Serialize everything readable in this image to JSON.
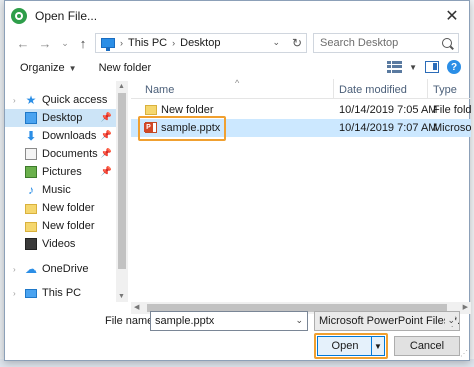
{
  "window": {
    "title": "Open File...",
    "close_glyph": "✕"
  },
  "nav": {
    "back_glyph": "←",
    "forward_glyph": "→",
    "recent_glyph": "⌄",
    "up_glyph": "↑",
    "breadcrumb": [
      "This PC",
      "Desktop"
    ],
    "crumb_sep": "›",
    "address_dropdown_glyph": "⌄",
    "refresh_glyph": "↻",
    "search_placeholder": "Search Desktop"
  },
  "toolbar": {
    "organize_label": "Organize",
    "organize_caret": "▼",
    "new_folder_label": "New folder",
    "view_caret": "▼",
    "help_glyph": "?"
  },
  "sidebar": {
    "items": [
      {
        "label": "Quick access",
        "icon": "star-icon",
        "glyph": "★"
      },
      {
        "label": "Desktop",
        "icon": "desktop-icon",
        "pinned": true
      },
      {
        "label": "Downloads",
        "icon": "download-icon",
        "glyph": "⬇",
        "pinned": true
      },
      {
        "label": "Documents",
        "icon": "documents-icon",
        "pinned": true
      },
      {
        "label": "Pictures",
        "icon": "pictures-icon",
        "pinned": true
      },
      {
        "label": "Music",
        "icon": "music-icon",
        "glyph": "♪"
      },
      {
        "label": "New folder",
        "icon": "folder-icon"
      },
      {
        "label": "New folder",
        "icon": "folder-icon"
      },
      {
        "label": "Videos",
        "icon": "videos-icon"
      },
      {
        "label": "OneDrive",
        "icon": "cloud-icon",
        "glyph": "☁"
      },
      {
        "label": "This PC",
        "icon": "pc-icon"
      }
    ],
    "pin_glyph": "📌",
    "expand_glyph": "›"
  },
  "filelist": {
    "columns": {
      "name": "Name",
      "date": "Date modified",
      "type": "Type"
    },
    "sort_glyph": "^",
    "rows": [
      {
        "name": "New folder",
        "date": "10/14/2019 7:05 AM",
        "type": "File folder",
        "icon": "folder-icon"
      },
      {
        "name": "sample.pptx",
        "date": "10/14/2019 7:07 AM",
        "type": "Microsoft",
        "icon": "powerpoint-file-icon",
        "selected": true
      }
    ]
  },
  "scroll": {
    "up_glyph": "▲",
    "down_glyph": "▼",
    "left_glyph": "◀",
    "right_glyph": "▶"
  },
  "footer": {
    "filename_label": "File name:",
    "filename_value": "sample.pptx",
    "filename_caret": "⌄",
    "filetype_value": "Microsoft PowerPoint Files(*.ppt",
    "filetype_caret": "⌄",
    "open_label": "Open",
    "open_split_glyph": "▼",
    "cancel_label": "Cancel",
    "grip_glyph": "⋰"
  },
  "colors": {
    "selection": "#cce8ff",
    "highlight_outline": "#f0a030",
    "accent": "#0078d7"
  }
}
